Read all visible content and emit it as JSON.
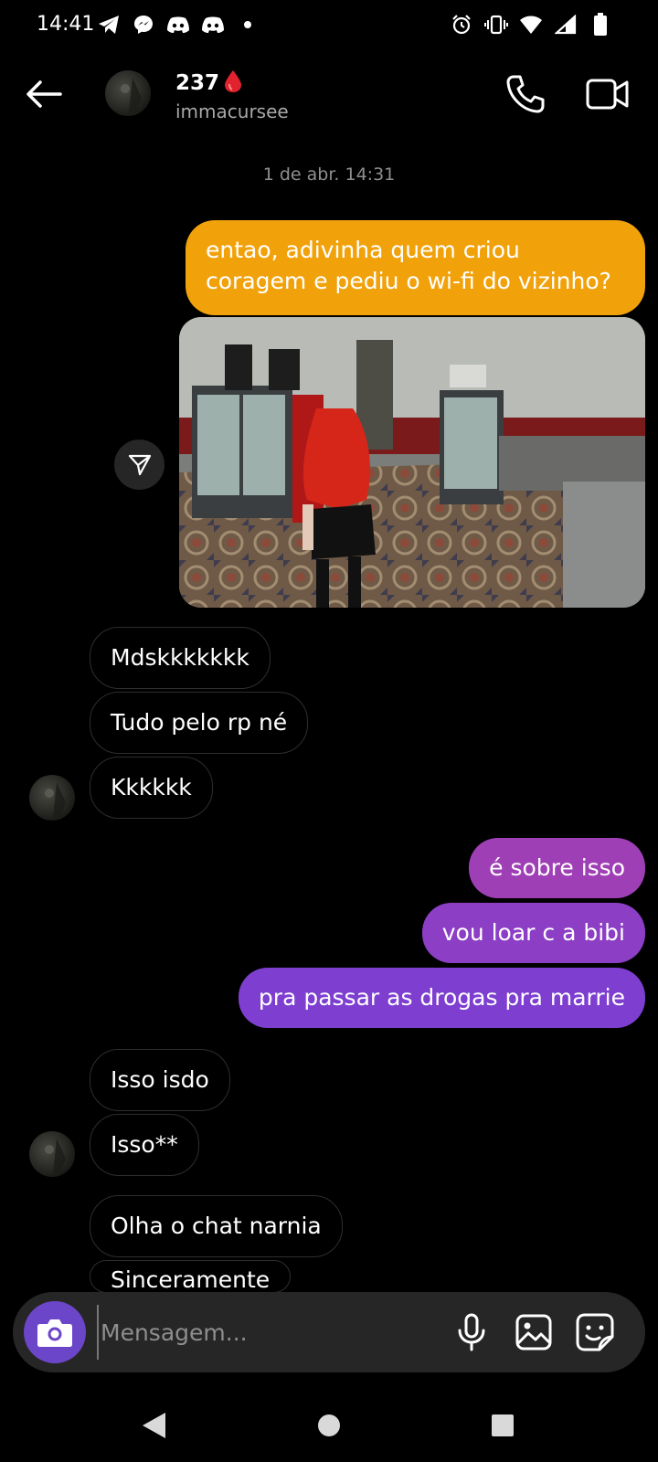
{
  "status_bar": {
    "time": "14:41",
    "left_icons": [
      "telegram-icon",
      "messenger-icon",
      "discord-icon",
      "discord-icon",
      "dot-icon"
    ],
    "right_icons": [
      "alarm-icon",
      "vibrate-icon",
      "wifi-icon",
      "signal-icon",
      "battery-icon"
    ]
  },
  "header": {
    "name": "237",
    "name_emoji": "blood-drop-icon",
    "username": "immacursee"
  },
  "conversation": {
    "timestamp": "1 de abr. 14:31",
    "messages": [
      {
        "dir": "out",
        "text": "entao, adivinha quem criou"
      },
      {
        "dir": "out",
        "text": "coragem e pediu o wi-fi do vizinho?"
      },
      {
        "dir": "in",
        "text": "Mdskkkkkkk"
      },
      {
        "dir": "in",
        "text": "Tudo pelo rp né"
      },
      {
        "dir": "in",
        "text": "Kkkkkk"
      },
      {
        "dir": "out",
        "text": "é sobre isso"
      },
      {
        "dir": "out",
        "text": "vou loar c a bibi"
      },
      {
        "dir": "out",
        "text": "pra passar as drogas pra marrie"
      },
      {
        "dir": "in",
        "text": "Isso isdo"
      },
      {
        "dir": "in",
        "text": "Isso**"
      },
      {
        "dir": "in",
        "text": "Olha o chat narnia"
      },
      {
        "dir": "in",
        "text": "Sinceramente"
      }
    ]
  },
  "composer": {
    "placeholder": "Mensagem..."
  },
  "colors": {
    "outgoing_orange": "#f1a20b",
    "outgoing_magenta": "#9f3fb5",
    "outgoing_purple": "#7e3fd1",
    "camera_button": "#6c46c8",
    "composer_bg": "#262626"
  }
}
